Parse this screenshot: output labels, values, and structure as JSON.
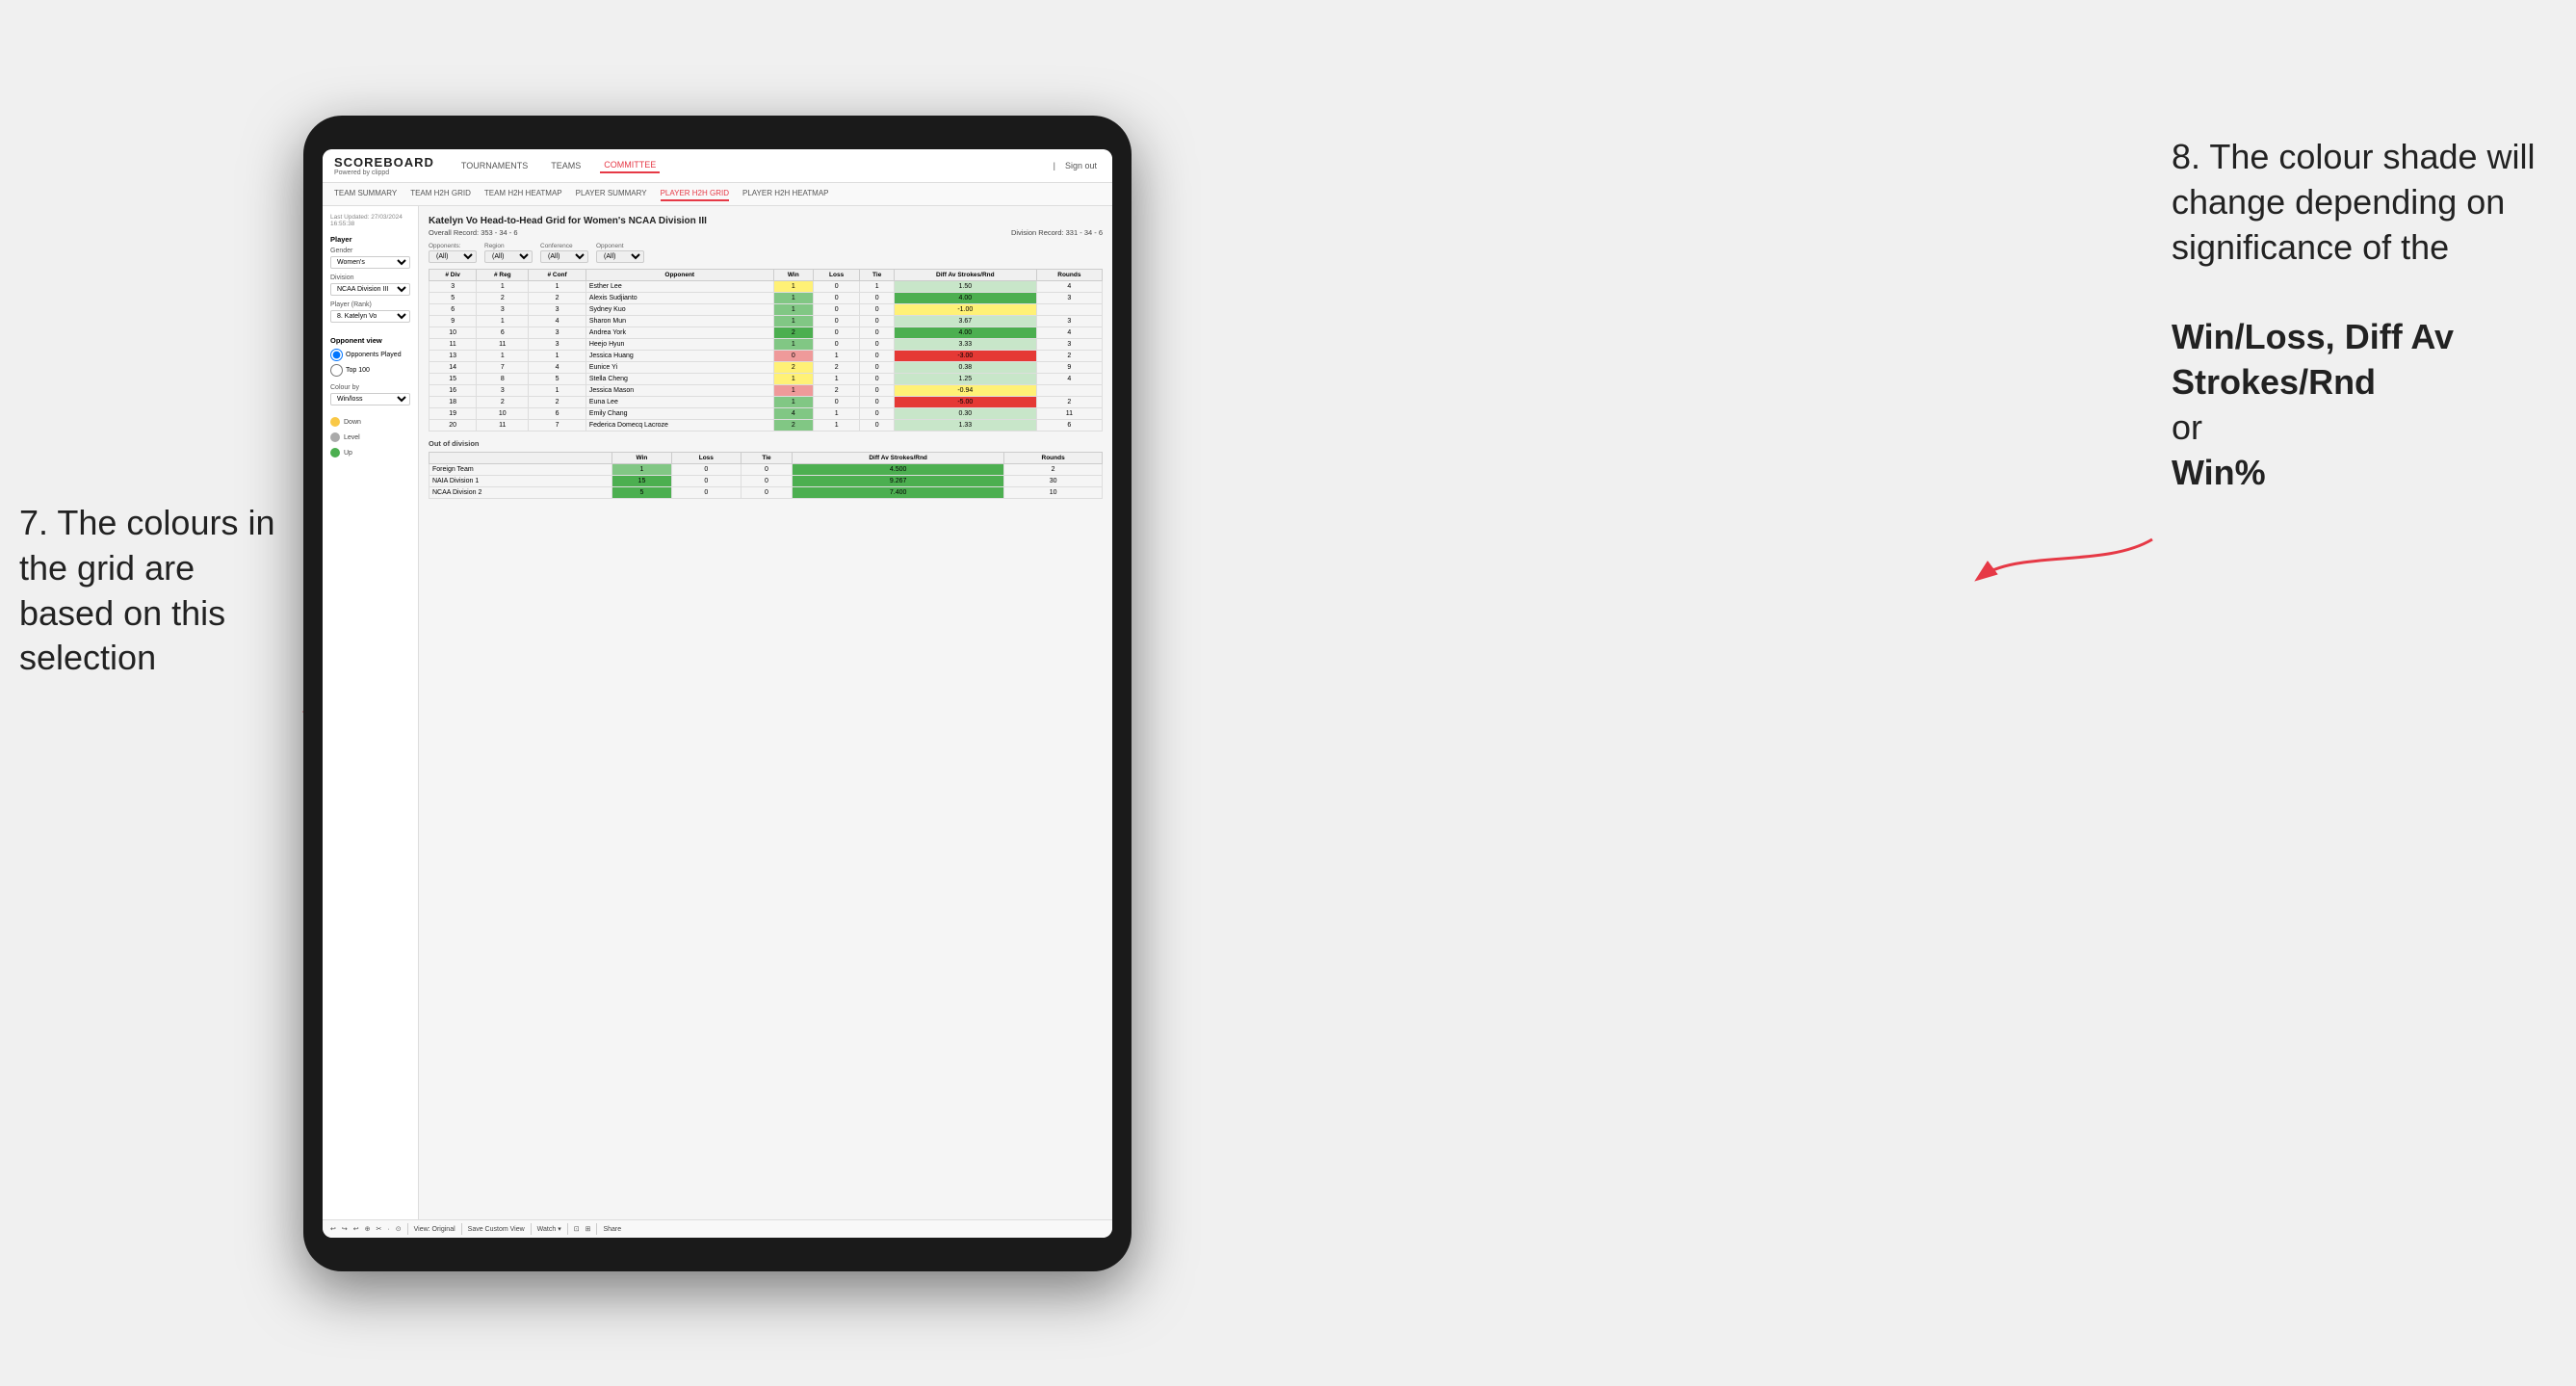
{
  "annotations": {
    "left_title": "7. The colours in the grid are based on this selection",
    "right_title": "8. The colour shade will change depending on significance of the",
    "right_bold1": "Win/Loss,",
    "right_bold2": "Diff Av Strokes/Rnd",
    "right_or": "or",
    "right_bold3": "Win%"
  },
  "nav": {
    "logo": "SCOREBOARD",
    "logo_sub": "Powered by clippd",
    "items": [
      "TOURNAMENTS",
      "TEAMS",
      "COMMITTEE"
    ],
    "active": "COMMITTEE",
    "sign_in": "Sign out"
  },
  "sub_nav": {
    "items": [
      "TEAM SUMMARY",
      "TEAM H2H GRID",
      "TEAM H2H HEATMAP",
      "PLAYER SUMMARY",
      "PLAYER H2H GRID",
      "PLAYER H2H HEATMAP"
    ],
    "active": "PLAYER H2H GRID"
  },
  "sidebar": {
    "timestamp": "Last Updated: 27/03/2024 16:55:38",
    "player_section": "Player",
    "gender_label": "Gender",
    "gender_value": "Women's",
    "division_label": "Division",
    "division_value": "NCAA Division III",
    "player_rank_label": "Player (Rank)",
    "player_rank_value": "8. Katelyn Vo",
    "opponent_view_label": "Opponent view",
    "radio1": "Opponents Played",
    "radio2": "Top 100",
    "colour_by_label": "Colour by",
    "colour_by_value": "Win/loss",
    "legend": [
      {
        "color": "#f9c846",
        "label": "Down"
      },
      {
        "color": "#aaa",
        "label": "Level"
      },
      {
        "color": "#4caf50",
        "label": "Up"
      }
    ]
  },
  "grid": {
    "title": "Katelyn Vo Head-to-Head Grid for Women's NCAA Division III",
    "overall_record_label": "Overall Record:",
    "overall_record": "353 - 34 - 6",
    "division_record_label": "Division Record:",
    "division_record": "331 - 34 - 6",
    "filter_opponents_label": "Opponents:",
    "filter_opponents_value": "(All)",
    "filter_conference_label": "Conference",
    "filter_conference_value": "(All)",
    "filter_opponent_label": "Opponent",
    "filter_opponent_value": "(All)",
    "columns": [
      "# Div",
      "# Reg",
      "# Conf",
      "Opponent",
      "Win",
      "Loss",
      "Tie",
      "Diff Av Strokes/Rnd",
      "Rounds"
    ],
    "rows": [
      {
        "div": "3",
        "reg": "1",
        "conf": "1",
        "opponent": "Esther Lee",
        "win": "1",
        "loss": "0",
        "tie": "1",
        "diff": "1.50",
        "rounds": "4",
        "win_color": "yellow",
        "diff_color": "green_light"
      },
      {
        "div": "5",
        "reg": "2",
        "conf": "2",
        "opponent": "Alexis Sudjianto",
        "win": "1",
        "loss": "0",
        "tie": "0",
        "diff": "4.00",
        "rounds": "3",
        "win_color": "green_mid",
        "diff_color": "green_dark"
      },
      {
        "div": "6",
        "reg": "3",
        "conf": "3",
        "opponent": "Sydney Kuo",
        "win": "1",
        "loss": "0",
        "tie": "0",
        "diff": "-1.00",
        "rounds": "",
        "win_color": "green_mid",
        "diff_color": "yellow"
      },
      {
        "div": "9",
        "reg": "1",
        "conf": "4",
        "opponent": "Sharon Mun",
        "win": "1",
        "loss": "0",
        "tie": "0",
        "diff": "3.67",
        "rounds": "3",
        "win_color": "green_mid",
        "diff_color": "green_light"
      },
      {
        "div": "10",
        "reg": "6",
        "conf": "3",
        "opponent": "Andrea York",
        "win": "2",
        "loss": "0",
        "tie": "0",
        "diff": "4.00",
        "rounds": "4",
        "win_color": "green_dark",
        "diff_color": "green_dark"
      },
      {
        "div": "11",
        "reg": "11",
        "conf": "3",
        "opponent": "Heejo Hyun",
        "win": "1",
        "loss": "0",
        "tie": "0",
        "diff": "3.33",
        "rounds": "3",
        "win_color": "green_mid",
        "diff_color": "green_light"
      },
      {
        "div": "13",
        "reg": "1",
        "conf": "1",
        "opponent": "Jessica Huang",
        "win": "0",
        "loss": "1",
        "tie": "0",
        "diff": "-3.00",
        "rounds": "2",
        "win_color": "red_light",
        "diff_color": "red_dark"
      },
      {
        "div": "14",
        "reg": "7",
        "conf": "4",
        "opponent": "Eunice Yi",
        "win": "2",
        "loss": "2",
        "tie": "0",
        "diff": "0.38",
        "rounds": "9",
        "win_color": "yellow",
        "diff_color": "green_light"
      },
      {
        "div": "15",
        "reg": "8",
        "conf": "5",
        "opponent": "Stella Cheng",
        "win": "1",
        "loss": "1",
        "tie": "0",
        "diff": "1.25",
        "rounds": "4",
        "win_color": "yellow",
        "diff_color": "green_light"
      },
      {
        "div": "16",
        "reg": "3",
        "conf": "1",
        "opponent": "Jessica Mason",
        "win": "1",
        "loss": "2",
        "tie": "0",
        "diff": "-0.94",
        "rounds": "",
        "win_color": "red_light",
        "diff_color": "yellow"
      },
      {
        "div": "18",
        "reg": "2",
        "conf": "2",
        "opponent": "Euna Lee",
        "win": "1",
        "loss": "0",
        "tie": "0",
        "diff": "-5.00",
        "rounds": "2",
        "win_color": "green_mid",
        "diff_color": "red_dark"
      },
      {
        "div": "19",
        "reg": "10",
        "conf": "6",
        "opponent": "Emily Chang",
        "win": "4",
        "loss": "1",
        "tie": "0",
        "diff": "0.30",
        "rounds": "11",
        "win_color": "green_mid",
        "diff_color": "green_light"
      },
      {
        "div": "20",
        "reg": "11",
        "conf": "7",
        "opponent": "Federica Domecq Lacroze",
        "win": "2",
        "loss": "1",
        "tie": "0",
        "diff": "1.33",
        "rounds": "6",
        "win_color": "green_mid",
        "diff_color": "green_light"
      }
    ],
    "out_of_division_label": "Out of division",
    "out_of_division_rows": [
      {
        "team": "Foreign Team",
        "win": "1",
        "loss": "0",
        "tie": "0",
        "diff": "4.500",
        "rounds": "2",
        "win_color": "green_mid",
        "diff_color": "green_dark"
      },
      {
        "team": "NAIA Division 1",
        "win": "15",
        "loss": "0",
        "tie": "0",
        "diff": "9.267",
        "rounds": "30",
        "win_color": "green_dark",
        "diff_color": "green_dark"
      },
      {
        "team": "NCAA Division 2",
        "win": "5",
        "loss": "0",
        "tie": "0",
        "diff": "7.400",
        "rounds": "10",
        "win_color": "green_dark",
        "diff_color": "green_dark"
      }
    ]
  },
  "toolbar": {
    "buttons": [
      "↩",
      "↪",
      "↩",
      "⊕",
      "✂",
      "·",
      "⊙",
      "|",
      "View: Original",
      "Save Custom View",
      "Watch ▾",
      "⊡",
      "⊞",
      "Share"
    ]
  }
}
